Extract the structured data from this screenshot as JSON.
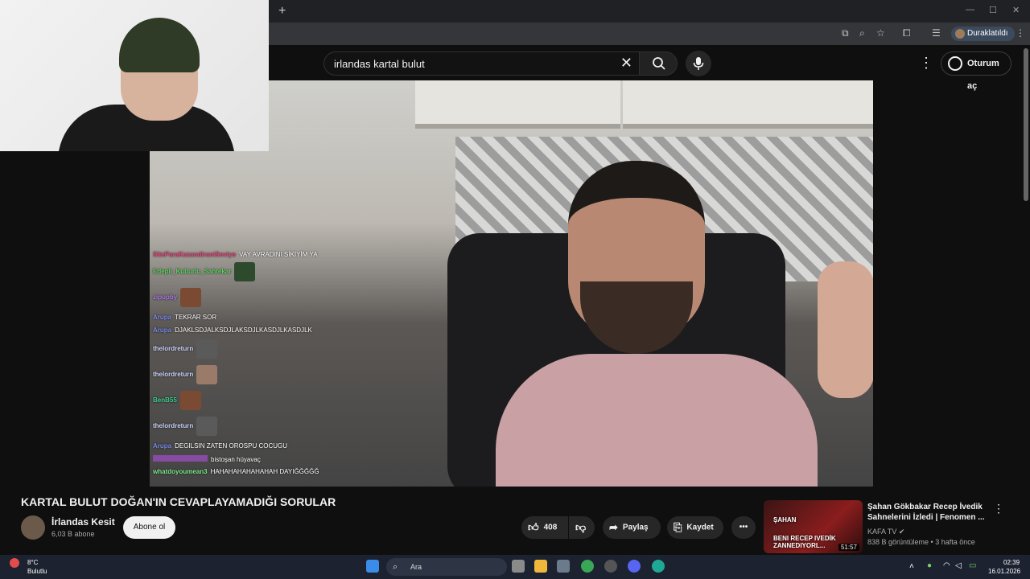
{
  "browser": {
    "new_tab": "+",
    "minimize": "—",
    "maximize": "☐",
    "close": "✕",
    "profile_status": "Duraklatıldı"
  },
  "header": {
    "search_value": "irlandas kartal bulut",
    "clear_label": "✕",
    "more_label": "⋮",
    "signin_label": "Oturum aç"
  },
  "chat": [
    {
      "user": "SiteParaKazandiraniSeviyo",
      "user_color": "#e6457a",
      "msg": "VAY AVRADINI SİKİYİM YA"
    },
    {
      "user": "Edepli_Kulturlu_Sahtekar",
      "user_color": "#5fd35f",
      "msg": ""
    },
    {
      "user": "zipupby",
      "user_color": "#b07ce8",
      "msg": ""
    },
    {
      "user": "Arupa",
      "user_color": "#7c8ce8",
      "msg": "TEKRAR SOR"
    },
    {
      "user": "Arupa",
      "user_color": "#7c8ce8",
      "msg": "DJAKLSDJALKSDJLAKSDJLKASDJLKASDJLK"
    },
    {
      "user": "thelordreturn",
      "user_color": "#cfd7ff",
      "msg": ""
    },
    {
      "user": "thelordreturn",
      "user_color": "#cfd7ff",
      "msg": ""
    },
    {
      "user": "BenB55",
      "user_color": "#3fcf8e",
      "msg": ""
    },
    {
      "user": "thelordreturn",
      "user_color": "#cfd7ff",
      "msg": ""
    },
    {
      "user": "Arupa",
      "user_color": "#7c8ce8",
      "msg": "DEGILSIN ZATEN OROSPU COCUGU"
    },
    {
      "user": "",
      "user_color": "#b04fe0",
      "msg": "bistoşan hüyavaç"
    },
    {
      "user": "whatdoyoumean3",
      "user_color": "#7dea8c",
      "msg": "HAHAHAHAHAHAHAH DAYIĞĞĞĞĞ"
    }
  ],
  "video": {
    "title": "KARTAL BULUT DOĞAN'IN CEVAPLAYAMADIĞI SORULAR",
    "channel_name": "İrlandas Kesit",
    "channel_subs": "6,03 B abone",
    "subscribe_label": "Abone ol",
    "like_count": "408",
    "share_label": "Paylaş",
    "save_label": "Kaydet",
    "more_label": "•••"
  },
  "recommendation": {
    "title": "Şahan Gökbakar Recep İvedik Sahnelerini İzledi | Fenomen ...",
    "channel": "KAFA TV",
    "meta": "838 B görüntüleme • 3 hafta önce",
    "duration": "51:57",
    "thumb_text": "BENI RECEP IVEDİK ZANNEDIYORL...",
    "thumb_name": "ŞAHAN"
  },
  "taskbar": {
    "weather_temp": "8°C",
    "weather_desc": "Bulutlu",
    "search_placeholder": "Ara",
    "time": "02:39",
    "date": "16.01.2026"
  },
  "colors": {
    "yt_bg": "#0f0f0f",
    "accent": "#f1f1f1",
    "chrome_bar": "#35363a"
  }
}
